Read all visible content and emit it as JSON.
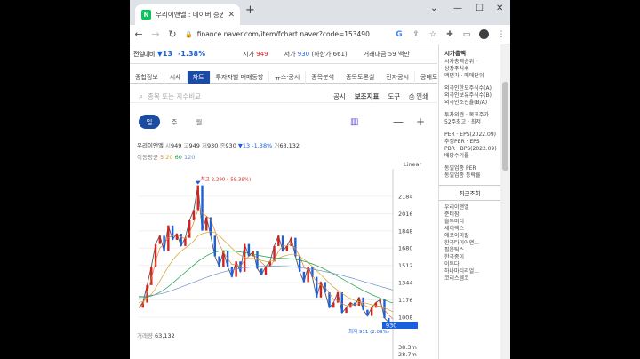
{
  "browser": {
    "tab_title": "우리이앤엘 : 네이버 증권",
    "favicon_letter": "N",
    "url": "finance.naver.com/item/fchart.naver?code=153490"
  },
  "stock_header": {
    "name": "전일대비",
    "change": "▼13",
    "pct": "-1.38%",
    "low_label": "시가",
    "low_value": "949",
    "high_label": "저가",
    "high_value": "930",
    "high_note": "(하한가 661)",
    "volume_label": "거래대금",
    "volume_value": "59 백만"
  },
  "nav_tabs": [
    "종합정보",
    "시세",
    "차트",
    "투자자별 매매동향",
    "뉴스·공시",
    "종목분석",
    "종목토론실",
    "전자공시",
    "공매도현황"
  ],
  "active_tab": "차트",
  "search": {
    "placeholder": "종목 또는 지수비교",
    "tools": [
      "공시",
      "보조지표",
      "도구"
    ],
    "print": "인쇄"
  },
  "period_buttons": [
    "일",
    "주",
    "월"
  ],
  "info": {
    "name": "우리이앤엘",
    "open_k": "시",
    "open": "949",
    "high_k": "고",
    "high": "949",
    "low_k": "저",
    "low": "930",
    "close_k": "종",
    "close": "930",
    "change": "▼13 -1.38%",
    "vol_k": "거",
    "vol": "63,132"
  },
  "ma": {
    "label": "이동평균",
    "p5": "5",
    "p20": "20",
    "p60": "60",
    "p120": "120"
  },
  "scale_label": "Linear",
  "volume": {
    "label": "거래량",
    "value": "63,132"
  },
  "chart_data": {
    "type": "line",
    "yticks": [
      2184,
      2016,
      1848,
      1680,
      1512,
      1344,
      1176,
      1008
    ],
    "ylim": [
      930,
      2330
    ],
    "max_label": "최고 2,290 (-59.39%)",
    "min_label": "최저 911 (2.09%)",
    "current_label": "930",
    "volume_ticks": [
      "38.3m",
      "28.7m"
    ],
    "series": [
      {
        "values": [
          1100,
          1150,
          1320,
          1500,
          1720,
          1800,
          1650,
          1900,
          1760,
          1820,
          1700,
          1780,
          1950,
          2050,
          2290,
          1850,
          1980,
          1800,
          1600,
          1500,
          1650,
          1500,
          1400,
          1550,
          1450,
          1720,
          1600,
          1650,
          1480,
          1420,
          1500,
          1550,
          1700,
          1800,
          1650,
          1700,
          1780,
          1600,
          1450,
          1350,
          1500,
          1400,
          1200,
          1350,
          1250,
          1100,
          1150,
          1250,
          1050,
          1100,
          1150,
          1120,
          1200,
          1080,
          1020,
          1100,
          1150,
          1180,
          1000,
          960,
          930
        ]
      },
      {
        "name": "5",
        "values": [
          1100,
          1130,
          1250,
          1380,
          1550,
          1680,
          1720,
          1780,
          1800,
          1810,
          1790,
          1770,
          1830,
          1930,
          2050,
          2020,
          1990,
          1960,
          1850,
          1720,
          1640,
          1580,
          1520,
          1520,
          1500,
          1560,
          1600,
          1620,
          1580,
          1540,
          1500,
          1500,
          1560,
          1650,
          1700,
          1700,
          1720,
          1680,
          1600,
          1500,
          1460,
          1420,
          1350,
          1320,
          1300,
          1240,
          1180,
          1170,
          1140,
          1120,
          1120,
          1130,
          1140,
          1130,
          1110,
          1100,
          1110,
          1120,
          1080,
          1030,
          990
        ]
      },
      {
        "name": "20",
        "values": [
          1150,
          1160,
          1190,
          1230,
          1290,
          1360,
          1430,
          1500,
          1560,
          1610,
          1650,
          1680,
          1710,
          1750,
          1800,
          1820,
          1830,
          1840,
          1830,
          1800,
          1760,
          1720,
          1680,
          1640,
          1610,
          1590,
          1580,
          1580,
          1570,
          1560,
          1550,
          1550,
          1560,
          1580,
          1600,
          1610,
          1620,
          1620,
          1600,
          1570,
          1540,
          1500,
          1460,
          1420,
          1380,
          1340,
          1300,
          1270,
          1240,
          1210,
          1190,
          1170,
          1160,
          1150,
          1140,
          1130,
          1120,
          1115,
          1100,
          1080,
          1060
        ]
      },
      {
        "name": "60",
        "values": [
          1200,
          1200,
          1205,
          1215,
          1230,
          1250,
          1275,
          1305,
          1340,
          1375,
          1410,
          1445,
          1480,
          1515,
          1550,
          1580,
          1605,
          1625,
          1640,
          1650,
          1655,
          1655,
          1652,
          1648,
          1642,
          1635,
          1628,
          1620,
          1612,
          1604,
          1596,
          1590,
          1585,
          1582,
          1580,
          1578,
          1575,
          1570,
          1562,
          1552,
          1540,
          1526,
          1510,
          1492,
          1472,
          1450,
          1428,
          1405,
          1382,
          1358,
          1335,
          1312,
          1290,
          1268,
          1248,
          1228,
          1210,
          1193,
          1176,
          1160,
          1145
        ]
      },
      {
        "name": "120",
        "values": [
          1210,
          1212,
          1215,
          1220,
          1226,
          1234,
          1244,
          1256,
          1270,
          1285,
          1300,
          1316,
          1332,
          1348,
          1364,
          1380,
          1395,
          1410,
          1424,
          1436,
          1448,
          1458,
          1467,
          1475,
          1482,
          1488,
          1493,
          1497,
          1500,
          1502,
          1503,
          1504,
          1504,
          1503,
          1502,
          1500,
          1497,
          1494,
          1490,
          1485,
          1480,
          1474,
          1467,
          1460,
          1452,
          1443,
          1434,
          1424,
          1414,
          1403,
          1392,
          1380,
          1368,
          1356,
          1344,
          1332,
          1320,
          1308,
          1296,
          1284,
          1272
        ]
      }
    ]
  },
  "right_panel": {
    "title": "시가총액",
    "items1": [
      "시가총액순위 ·",
      "상장주식수",
      "액면가 · 매매단위"
    ],
    "items2": [
      "외국인한도주식수(A)",
      "외국인보유주식수(B)",
      "외국인소진율(B/A)"
    ],
    "items3": [
      "투자의견 · 목표주가",
      "52주최고 · 최저"
    ],
    "items4": [
      "PER · EPS(2022.09)",
      "추정PER · EPS",
      "PBR · BPS(2022.09)",
      "배당수익률"
    ],
    "items5": [
      "동일업종 PER",
      "동일업종 등락률"
    ],
    "recent_title": "최근조회",
    "recent": [
      "우리이앤엘",
      "준티잠",
      "솔루비티",
      "세이렉스",
      "에코이미칼",
      "한국타이어앤...",
      "필옵틱스",
      "한국종이",
      "이투다",
      "하나마티리얼...",
      "코리스템코"
    ]
  },
  "colors": {
    "up": "#d22222",
    "down": "#1a5fdc",
    "accent": "#1c4ba3"
  }
}
